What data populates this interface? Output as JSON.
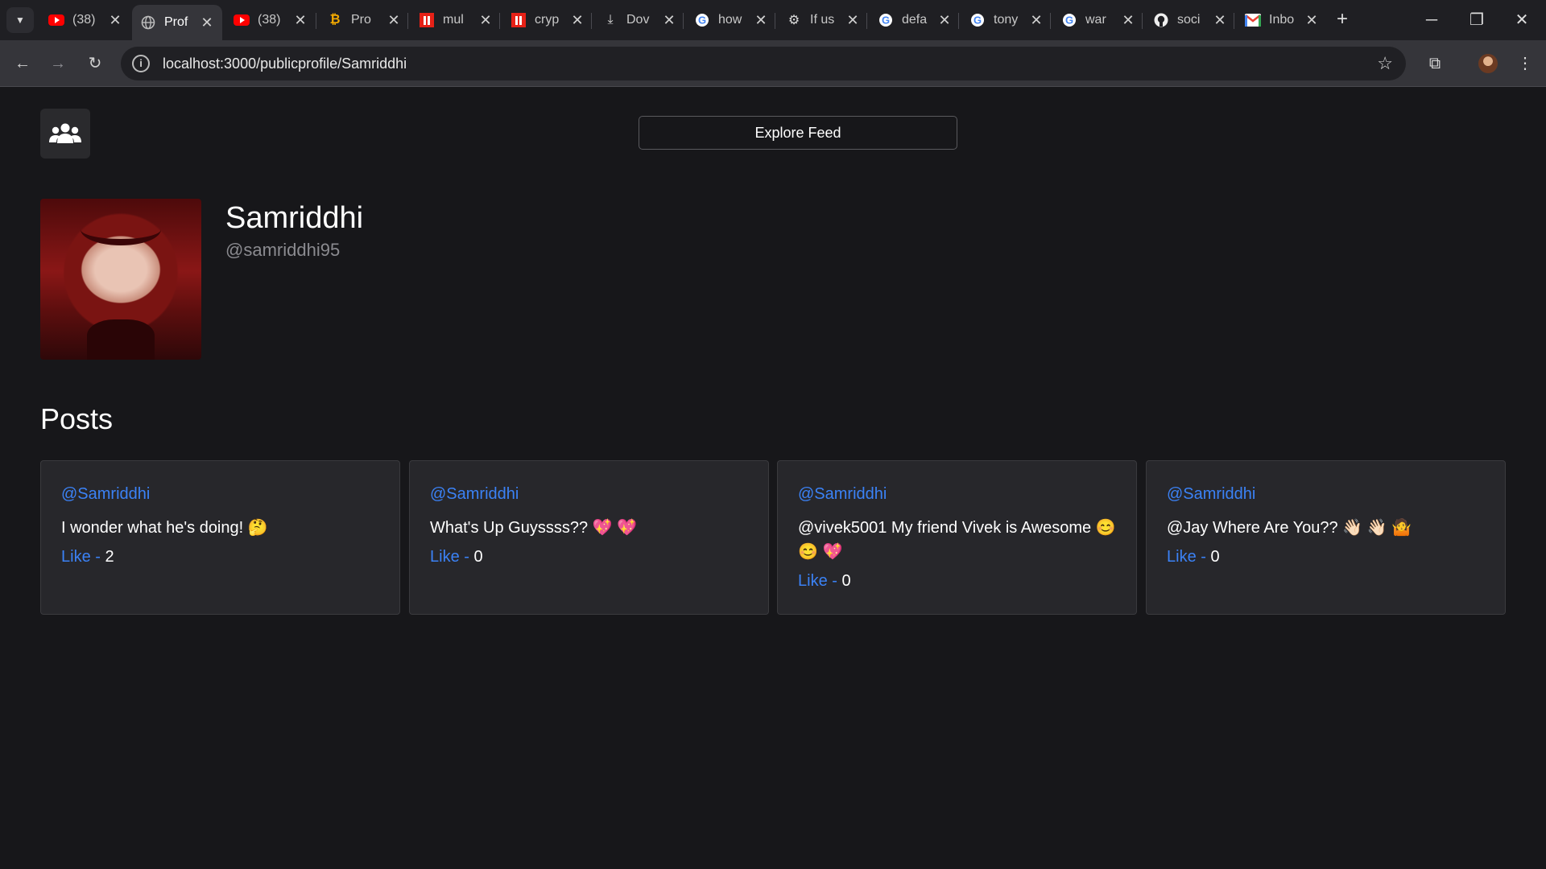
{
  "browser": {
    "tabs": [
      {
        "title": "(38)",
        "icon": "youtube-icon"
      },
      {
        "title": "Prof",
        "icon": "globe-icon",
        "active": true
      },
      {
        "title": "(38)",
        "icon": "youtube-icon"
      },
      {
        "title": "Pro",
        "icon": "bitcoin-icon"
      },
      {
        "title": "mul",
        "icon": "medium-icon"
      },
      {
        "title": "cryp",
        "icon": "medium-icon"
      },
      {
        "title": "Dov",
        "icon": "download-icon"
      },
      {
        "title": "how",
        "icon": "google-icon"
      },
      {
        "title": "If us",
        "icon": "openai-icon"
      },
      {
        "title": "defa",
        "icon": "google-icon"
      },
      {
        "title": "tony",
        "icon": "google-icon"
      },
      {
        "title": "war",
        "icon": "google-icon"
      },
      {
        "title": "soci",
        "icon": "github-icon"
      },
      {
        "title": "Inbo",
        "icon": "gmail-icon"
      }
    ],
    "url": "localhost:3000/publicprofile/Samriddhi"
  },
  "header": {
    "explore_label": "Explore Feed"
  },
  "profile": {
    "name": "Samriddhi",
    "handle": "@samriddhi95"
  },
  "posts_section": {
    "title": "Posts",
    "posts": [
      {
        "author": "@Samriddhi",
        "text": "I wonder what he's doing! 🤔",
        "like_label": "Like - ",
        "likes": "2"
      },
      {
        "author": "@Samriddhi",
        "text": "What's Up Guyssss?? 💖 💖",
        "like_label": "Like - ",
        "likes": "0"
      },
      {
        "author": "@Samriddhi",
        "text": "@vivek5001 My friend Vivek is Awesome 😊 😊 💖",
        "like_label": "Like - ",
        "likes": "0"
      },
      {
        "author": "@Samriddhi",
        "text": "@Jay Where Are You?? 👋🏻 👋🏻 🤷",
        "like_label": "Like - ",
        "likes": "0"
      }
    ]
  },
  "colors": {
    "background": "#17171a",
    "card": "#27272b",
    "link": "#3b82f6"
  }
}
